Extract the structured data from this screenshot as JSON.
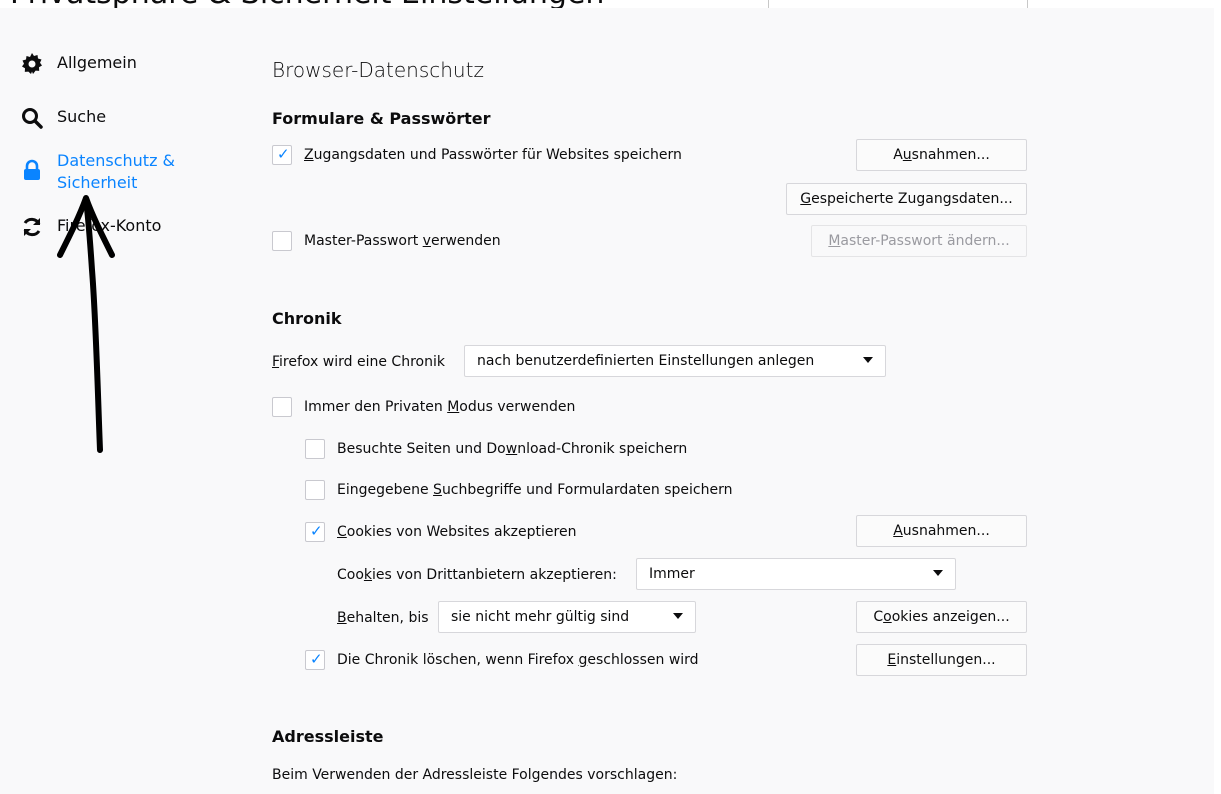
{
  "top": {
    "cut_text": "Privatsphäre & Sicherheit Einstellungen"
  },
  "sidebar": {
    "items": [
      {
        "label": "Allgemein",
        "icon": "gear-icon"
      },
      {
        "label": "Suche",
        "icon": "search-icon"
      },
      {
        "label_line1": "Datenschutz &",
        "label_line2": "Sicherheit",
        "icon": "lock-icon",
        "selected": true
      },
      {
        "label": "Firefox-Konto",
        "icon": "sync-icon"
      }
    ]
  },
  "main": {
    "title": "Browser-Datenschutz",
    "forms": {
      "heading": "Formulare & Passwörter",
      "save_logins": {
        "pre": "",
        "ul": "Z",
        "post": "ugangsdaten und Passwörter für Websites speichern",
        "checked": true
      },
      "exceptions_btn": {
        "pre": "A",
        "ul": "u",
        "post": "snahmen..."
      },
      "saved_logins_btn": {
        "pre": "",
        "ul": "G",
        "post": "espeicherte Zugangsdaten..."
      },
      "master_pw": {
        "pre": "Master-Passwort ",
        "ul": "v",
        "post": "erwenden",
        "checked": false
      },
      "master_pw_btn": {
        "pre": "",
        "ul": "M",
        "post": "aster-Passwort ändern..."
      }
    },
    "history": {
      "heading": "Chronik",
      "firefox_will": {
        "pre": "",
        "ul": "F",
        "post": "irefox wird eine Chronik"
      },
      "mode_select": "nach benutzerdefinierten Einstellungen anlegen",
      "private_mode": {
        "pre": "Immer den Privaten ",
        "ul": "M",
        "post": "odus verwenden",
        "checked": false
      },
      "visited": {
        "pre": "Besuchte Seiten und Do",
        "ul": "w",
        "post": "nload-Chronik speichern",
        "checked": false
      },
      "search_form": {
        "pre": "Eingegebene ",
        "ul": "S",
        "post": "uchbegriffe und Formulardaten speichern",
        "checked": false
      },
      "cookies": {
        "pre": "",
        "ul": "C",
        "post": "ookies von Websites akzeptieren",
        "checked": true
      },
      "cookies_exceptions_btn": {
        "pre": "",
        "ul": "A",
        "post": "usnahmen..."
      },
      "third_party": {
        "pre": "Coo",
        "ul": "k",
        "post": "ies von Drittanbietern akzeptieren:"
      },
      "third_party_select": "Immer",
      "keep_until": {
        "pre": "",
        "ul": "B",
        "post": "ehalten, bis"
      },
      "keep_select": "sie nicht mehr gültig sind",
      "show_cookies_btn": {
        "pre": "C",
        "ul": "o",
        "post": "okies anzeigen..."
      },
      "clear_on_close": {
        "pre": "Die Chronik löschen, wenn Firefox ",
        "ul": "g",
        "post": "eschlossen wird",
        "checked": true
      },
      "settings_btn": {
        "pre": "",
        "ul": "E",
        "post": "instellungen..."
      }
    },
    "addressbar": {
      "heading": "Adressleiste",
      "desc": "Beim Verwenden der Adressleiste Folgendes vorschlagen:"
    }
  },
  "colors": {
    "accent": "#0a84ff",
    "background": "#f9f9fa",
    "annotation": "#000000"
  }
}
